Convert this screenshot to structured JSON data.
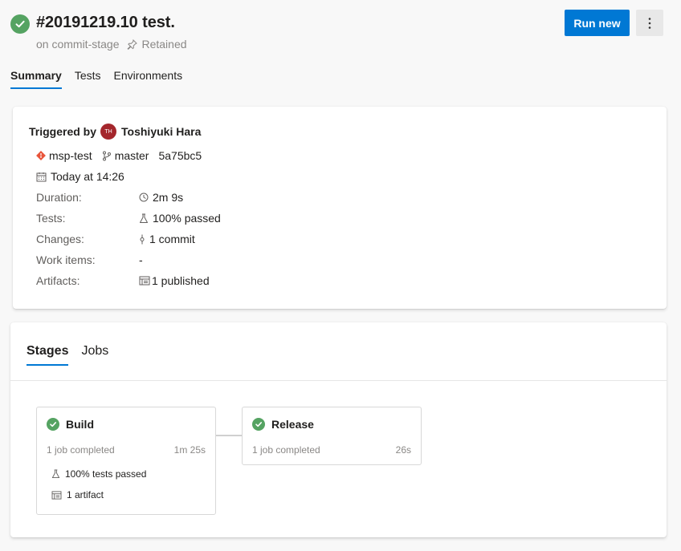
{
  "header": {
    "title": "#20191219.10 test.",
    "branch_text": "on commit-stage",
    "retained_text": "Retained",
    "run_new_label": "Run new"
  },
  "tabs": [
    {
      "label": "Summary",
      "active": true
    },
    {
      "label": "Tests",
      "active": false
    },
    {
      "label": "Environments",
      "active": false
    }
  ],
  "summary": {
    "triggered_label": "Triggered by",
    "avatar_initials": "TH",
    "user_name": "Toshiyuki Hara",
    "repo": "msp-test",
    "branch": "master",
    "commit": "5a75bc5",
    "date": "Today at 14:26",
    "rows": [
      {
        "key": "Duration:",
        "value": "2m 9s",
        "icon": "clock-icon"
      },
      {
        "key": "Tests:",
        "value": "100% passed",
        "icon": "flask-icon"
      },
      {
        "key": "Changes:",
        "value": "1 commit",
        "icon": "commit-icon"
      },
      {
        "key": "Work items:",
        "value": "-",
        "icon": ""
      },
      {
        "key": "Artifacts:",
        "value": "1 published",
        "icon": "artifact-icon"
      }
    ]
  },
  "stages_section": {
    "tabs": [
      {
        "label": "Stages",
        "active": true
      },
      {
        "label": "Jobs",
        "active": false
      }
    ],
    "stages": [
      {
        "name": "Build",
        "status": "1 job completed",
        "duration": "1m 25s",
        "tests": "100% tests passed",
        "artifacts": "1 artifact"
      },
      {
        "name": "Release",
        "status": "1 job completed",
        "duration": "26s"
      }
    ]
  },
  "colors": {
    "success": "#55a362",
    "accent": "#0078d4",
    "avatar": "#a4262c",
    "git": "#e8543a"
  }
}
